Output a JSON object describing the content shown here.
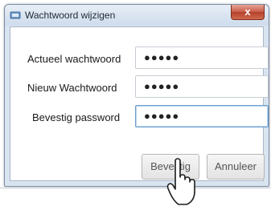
{
  "window": {
    "title": "Wachtwoord wijzigen",
    "close_label": "x"
  },
  "form": {
    "fields": [
      {
        "label": "Actueel wachtwoord",
        "value": "●●●●●",
        "focused": false
      },
      {
        "label": "Nieuw Wachtwoord",
        "value": "●●●●●",
        "focused": false
      },
      {
        "label": "Bevestig password",
        "value": "●●●●●",
        "focused": true
      }
    ]
  },
  "buttons": {
    "confirm_label": "Bevestig",
    "cancel_label": "Annuleer"
  },
  "icons": {
    "app": "app-icon",
    "close": "close-icon",
    "cursor": "hand-pointer-icon"
  }
}
